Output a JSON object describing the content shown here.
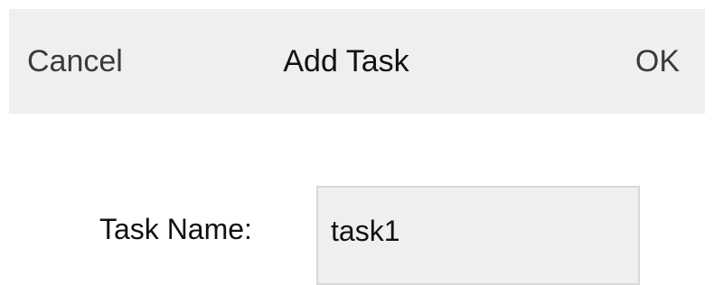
{
  "header": {
    "cancel_label": "Cancel",
    "title": "Add Task",
    "ok_label": "OK"
  },
  "form": {
    "task_name_label": "Task Name:",
    "task_name_value": "task1"
  }
}
